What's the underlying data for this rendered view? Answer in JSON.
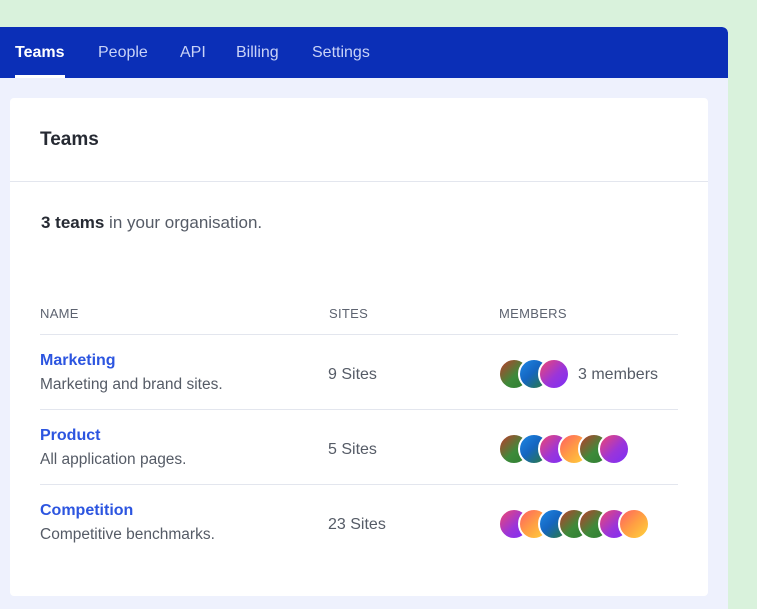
{
  "nav": {
    "tabs": [
      {
        "label": "Teams",
        "active": true
      },
      {
        "label": "People",
        "active": false
      },
      {
        "label": "API",
        "active": false
      },
      {
        "label": "Billing",
        "active": false
      },
      {
        "label": "Settings",
        "active": false
      }
    ]
  },
  "card": {
    "title": "Teams",
    "summary": {
      "count": "3 teams",
      "suffix": " in your organisation."
    }
  },
  "table": {
    "headers": {
      "name": "NAME",
      "sites": "SITES",
      "members": "MEMBERS"
    },
    "rows": [
      {
        "name": "Marketing",
        "description": "Marketing and brand sites.",
        "sites": "9 Sites",
        "members_label": "3 members",
        "avatars": [
          "avatar-green",
          "avatar-blue",
          "avatar-purple"
        ]
      },
      {
        "name": "Product",
        "description": "All application pages.",
        "sites": "5 Sites",
        "members_label": "",
        "avatars": [
          "avatar-green",
          "avatar-blue",
          "avatar-purple",
          "avatar-orange",
          "avatar-green",
          "avatar-purple"
        ]
      },
      {
        "name": "Competition",
        "description": "Competitive benchmarks.",
        "sites": "23 Sites",
        "members_label": "",
        "avatars": [
          "avatar-purple",
          "avatar-orange",
          "avatar-blue",
          "avatar-green",
          "avatar-green",
          "avatar-purple",
          "avatar-orange"
        ]
      }
    ]
  },
  "colors": {
    "nav_background": "#0b2fb7",
    "page_background": "#eef1fd",
    "outer_background": "#d9f2dc",
    "link": "#2c55e0",
    "avatar_green": "#3d8a3a",
    "avatar_blue": "#1e88e5",
    "avatar_purple": "#9b35d9",
    "avatar_orange": "#ff9f43"
  }
}
